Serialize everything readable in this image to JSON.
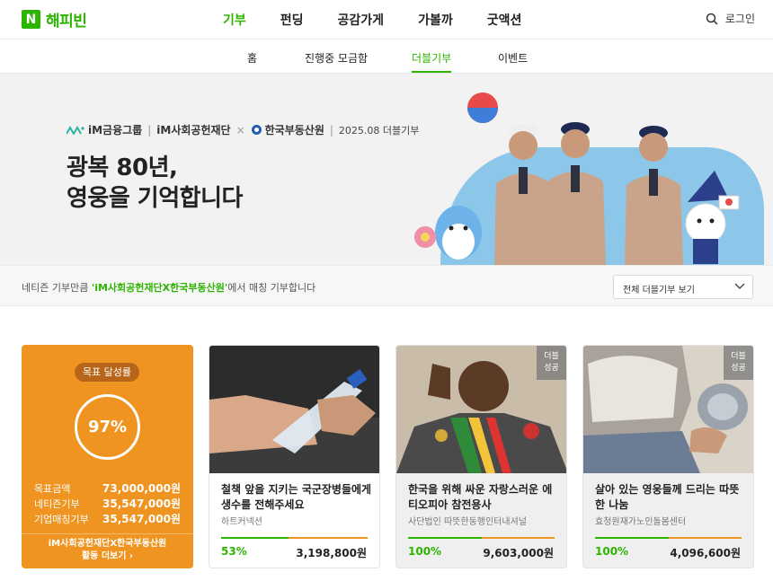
{
  "header": {
    "logo_badge": "N",
    "logo_text": "해피빈",
    "nav": [
      "기부",
      "펀딩",
      "공감가게",
      "가볼까",
      "굿액션"
    ],
    "login": "로그인"
  },
  "subnav": {
    "items": [
      "홈",
      "진행중 모금함",
      "더블기부",
      "이벤트"
    ]
  },
  "banner": {
    "partner1": "iM금융그룹",
    "partner2": "iM사회공헌재단",
    "cross": "×",
    "partner3": "한국부동산원",
    "date": "2025.08 더블기부",
    "headline_line1": "광복 80년,",
    "headline_line2": "영웅을 기억합니다"
  },
  "matchbar": {
    "prefix": "네티즌 기부만큼 ",
    "highlight": "'iM사회공헌재단X한국부동산원'",
    "suffix": "에서 매칭 기부합니다",
    "view_all": "전체 더블기부 보기"
  },
  "goal": {
    "pill": "목표 달성률",
    "percent": "97%",
    "rows": [
      {
        "label": "목표금액",
        "value": "73,000,000원"
      },
      {
        "label": "네티즌기부",
        "value": "35,547,000원"
      },
      {
        "label": "기업매칭기부",
        "value": "35,547,000원"
      }
    ],
    "footer_line1": "iM사회공헌재단X한국부동산원",
    "footer_line2": "활동 더보기 ›"
  },
  "cards": [
    {
      "title": "철책 앞을 지키는 국군장병들에게 생수를 전해주세요",
      "org": "하트커넥션",
      "percent": "53%",
      "amount": "3,198,800원",
      "progress": 0.53,
      "badge": ""
    },
    {
      "title": "한국을 위해 싸운 자랑스러운 에티오피아 참전용사",
      "org": "사단법인 따뜻한동행인터내셔널",
      "percent": "100%",
      "amount": "9,603,000원",
      "progress": 1.0,
      "badge": "더블 성공"
    },
    {
      "title": "살아 있는 영웅들께 드리는 따뜻한 나눔",
      "org": "효청원재가노인돌봄센터",
      "percent": "100%",
      "amount": "4,096,600원",
      "progress": 1.0,
      "badge": "더블 성공"
    }
  ],
  "colors": {
    "brand_green": "#2db400",
    "accent_orange": "#ef9420"
  }
}
